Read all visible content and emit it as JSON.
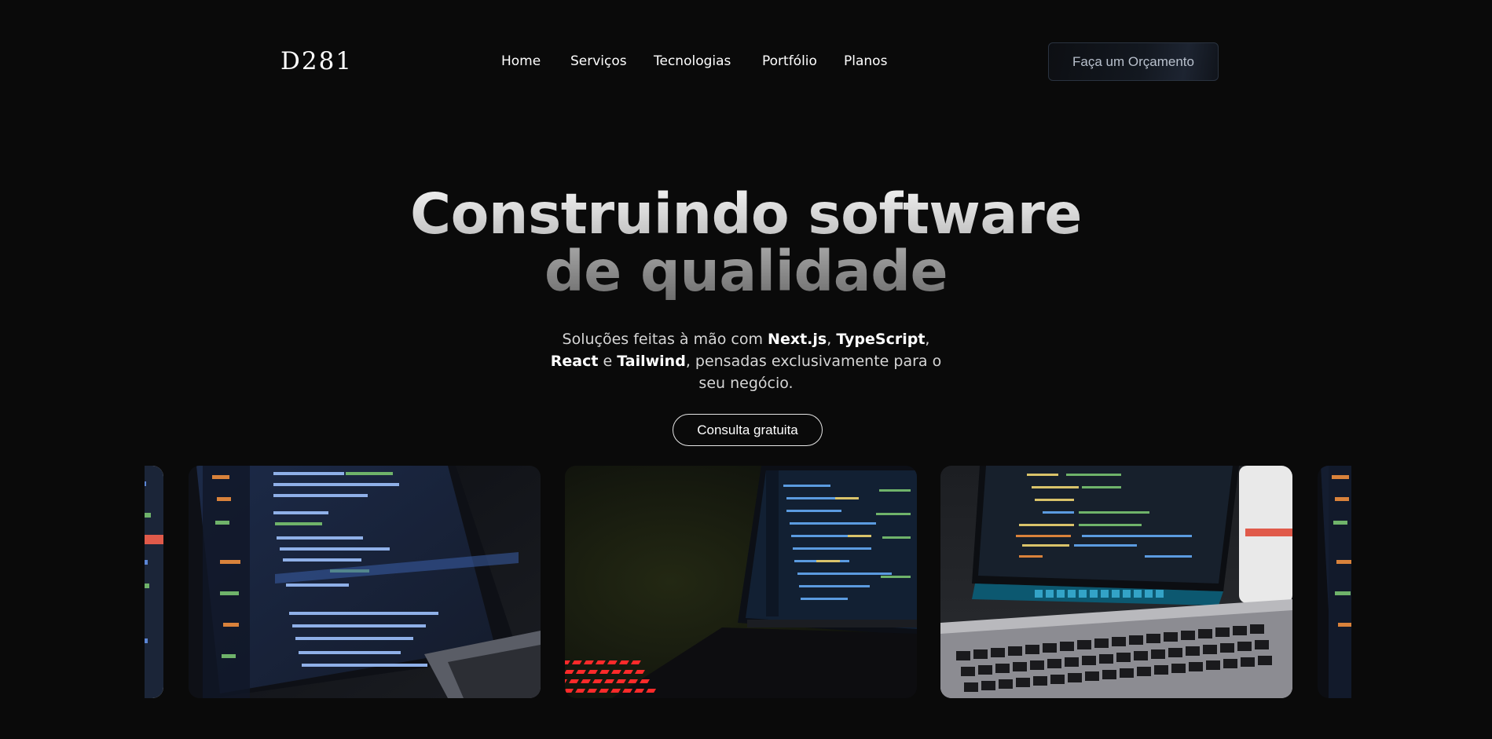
{
  "brand": {
    "logo": "D281"
  },
  "nav": {
    "items": [
      {
        "label": "Home"
      },
      {
        "label": "Serviços"
      },
      {
        "label": "Tecnologias"
      },
      {
        "label": "Portfólio"
      },
      {
        "label": "Planos"
      }
    ],
    "cta_label": "Faça um Orçamento"
  },
  "hero": {
    "title_line1": "Construindo software",
    "title_line2": "de qualidade",
    "subtitle": {
      "p1": "Soluções feitas à mão com ",
      "b1": "Next.js",
      "p2": ", ",
      "b2": "TypeScript",
      "p3": ",",
      "b3": "React",
      "p4": " e ",
      "b4": "Tailwind",
      "p5": ", pensadas exclusivamente para o",
      "p6": "seu negócio."
    },
    "cta_label": "Consulta gratuita"
  },
  "gallery": {
    "slides": [
      {
        "name": "laptop-code-editor-photo"
      },
      {
        "name": "laptop-code-editor-blue-photo"
      },
      {
        "name": "laptop-red-keyboard-photo"
      },
      {
        "name": "macbook-code-editor-photo"
      },
      {
        "name": "laptop-code-editor-blue-photo"
      }
    ],
    "colors": {
      "screen_bg": "#1a2436",
      "code_blue": "#5b86d6",
      "code_green": "#6fb36a",
      "code_orange": "#d9823b",
      "keyboard_red": "#ff2a2a"
    }
  }
}
